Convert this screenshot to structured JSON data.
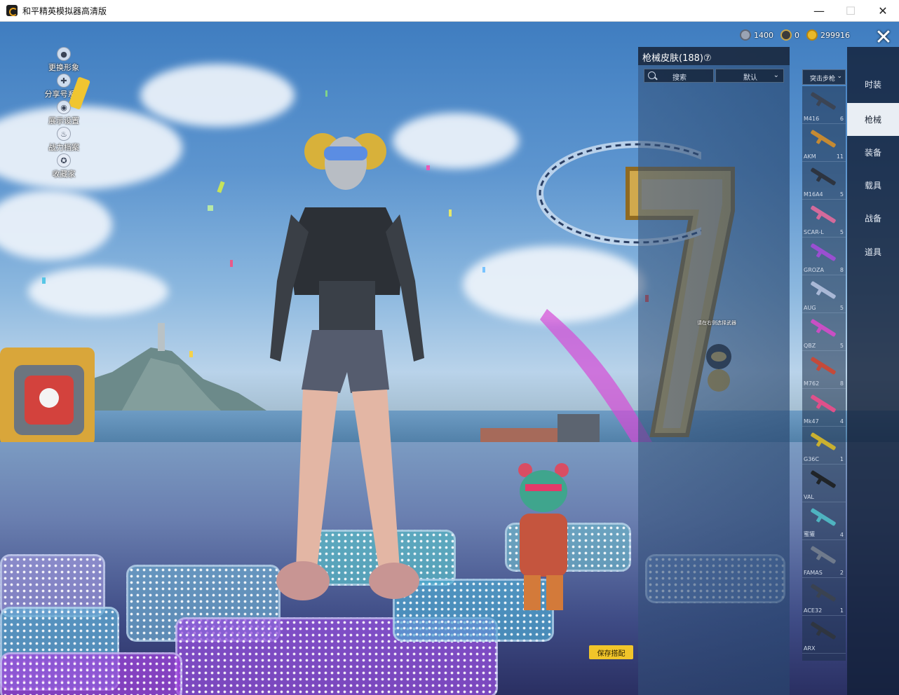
{
  "window": {
    "title": "和平精英模拟器高清版",
    "min_glyph": "—",
    "max_glyph": "☐",
    "close_glyph": "✕"
  },
  "left_menu": [
    {
      "label": "更换形象",
      "icon": "person-icon",
      "glyph": "●"
    },
    {
      "label": "分享号系牌",
      "icon": "share-icon",
      "glyph": "✚"
    },
    {
      "label": "展示设置",
      "icon": "eye-icon",
      "glyph": "◉"
    },
    {
      "label": "战力档案",
      "icon": "flame-icon",
      "glyph": "♨"
    },
    {
      "label": "收藏家",
      "icon": "medal-icon",
      "glyph": "✪"
    }
  ],
  "currency": [
    {
      "icon": "silver-coin-icon",
      "value": "1400",
      "color": "#9aa3b3"
    },
    {
      "icon": "token-icon",
      "value": "0",
      "color": "#c9a64a"
    },
    {
      "icon": "gold-coin-icon",
      "value": "299916",
      "color": "#e8b92a"
    }
  ],
  "close_glyph": "✕",
  "skin_panel": {
    "title": "枪械皮肤(188)⑦",
    "search_label": "搜索",
    "sort_label": "默认",
    "chevron": "⌄"
  },
  "weapon_filter": {
    "label": "突击步枪",
    "chevron": "⌄"
  },
  "weapons": [
    {
      "name": "M416",
      "count": "6",
      "color": "#3b4454"
    },
    {
      "name": "AKM",
      "count": "11",
      "color": "#c58a33"
    },
    {
      "name": "M16A4",
      "count": "5",
      "color": "#2d3440"
    },
    {
      "name": "SCAR-L",
      "count": "5",
      "color": "#d36a9b"
    },
    {
      "name": "GROZA",
      "count": "8",
      "color": "#9a4fd1"
    },
    {
      "name": "AUG",
      "count": "5",
      "color": "#a9b8d6"
    },
    {
      "name": "QBZ",
      "count": "5",
      "color": "#c94fc4"
    },
    {
      "name": "M762",
      "count": "8",
      "color": "#c44a3a"
    },
    {
      "name": "Mk47",
      "count": "4",
      "color": "#e0508a"
    },
    {
      "name": "G36C",
      "count": "1",
      "color": "#c9b030"
    },
    {
      "name": "VAL",
      "count": "",
      "color": "#202428"
    },
    {
      "name": "蜜獾",
      "count": "4",
      "color": "#4fb3c0"
    },
    {
      "name": "FAMAS",
      "count": "2",
      "color": "#6f7a8c"
    },
    {
      "name": "ACE32",
      "count": "1",
      "color": "#3a4250"
    },
    {
      "name": "ARX",
      "count": "",
      "color": "#2f3540"
    }
  ],
  "nav_tabs": [
    {
      "label": "时装",
      "active": false
    },
    {
      "label": "枪械",
      "active": true
    },
    {
      "label": "装备",
      "active": false
    },
    {
      "label": "载具",
      "active": false
    },
    {
      "label": "战备",
      "active": false
    },
    {
      "label": "道具",
      "active": false
    }
  ],
  "save_button": "保存搭配",
  "hint_text": "请在右侧选择武器"
}
